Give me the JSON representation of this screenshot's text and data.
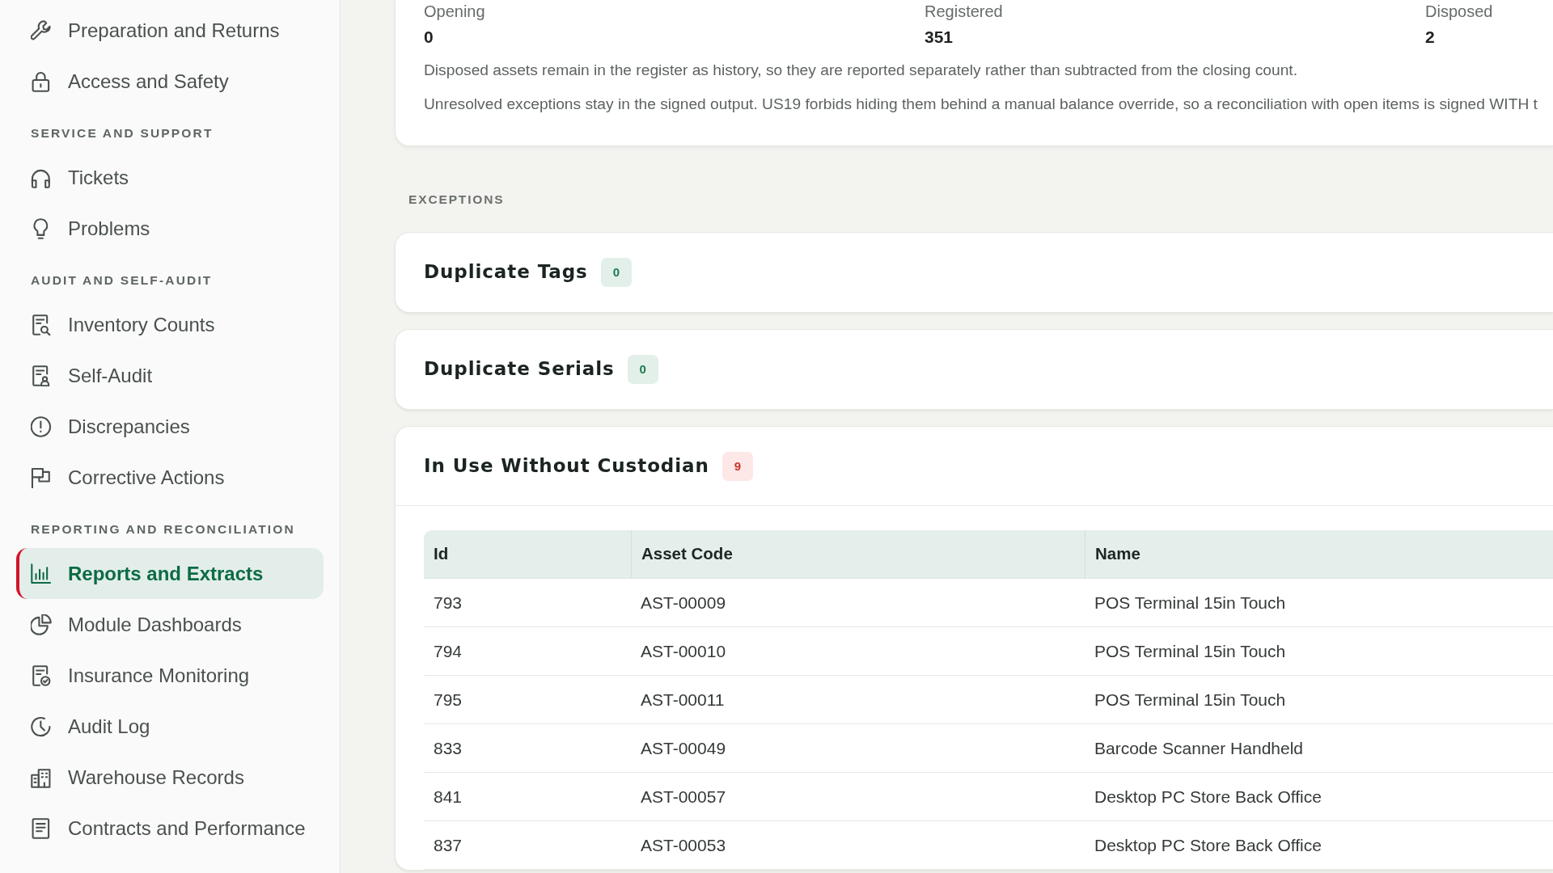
{
  "sidebar": {
    "sections": [
      {
        "items": [
          {
            "label": "Preparation and Returns",
            "selected": false
          },
          {
            "label": "Access and Safety",
            "selected": false
          }
        ]
      },
      {
        "heading": "SERVICE AND SUPPORT",
        "items": [
          {
            "label": "Tickets",
            "selected": false
          },
          {
            "label": "Problems",
            "selected": false
          }
        ]
      },
      {
        "heading": "AUDIT AND SELF-AUDIT",
        "items": [
          {
            "label": "Inventory Counts",
            "selected": false
          },
          {
            "label": "Self-Audit",
            "selected": false
          },
          {
            "label": "Discrepancies",
            "selected": false
          },
          {
            "label": "Corrective Actions",
            "selected": false
          }
        ]
      },
      {
        "heading": "REPORTING AND RECONCILIATION",
        "items": [
          {
            "label": "Reports and Extracts",
            "selected": true
          },
          {
            "label": "Module Dashboards",
            "selected": false
          },
          {
            "label": "Insurance Monitoring",
            "selected": false
          },
          {
            "label": "Audit Log",
            "selected": false
          },
          {
            "label": "Warehouse Records",
            "selected": false
          },
          {
            "label": "Contracts and Performance",
            "selected": false
          }
        ]
      }
    ]
  },
  "summary": {
    "stats": [
      {
        "label": "Opening",
        "value": "0"
      },
      {
        "label": "Registered",
        "value": "351"
      },
      {
        "label": "Disposed",
        "value": "2"
      }
    ],
    "notes": [
      "Disposed assets remain in the register as history, so they are reported separately rather than subtracted from the closing count.",
      "Unresolved exceptions stay in the signed output. US19 forbids hiding them behind a manual balance override, so a reconciliation with open items is signed WITH t"
    ]
  },
  "exceptions": {
    "heading": "EXCEPTIONS",
    "items": [
      {
        "title": "Duplicate Tags",
        "count": "0",
        "flagged": false
      },
      {
        "title": "Duplicate Serials",
        "count": "0",
        "flagged": false
      },
      {
        "title": "In Use Without Custodian",
        "count": "9",
        "flagged": true,
        "table": {
          "columns": [
            "Id",
            "Asset Code",
            "Name"
          ],
          "rows": [
            [
              "793",
              "AST-00009",
              "POS Terminal 15in Touch"
            ],
            [
              "794",
              "AST-00010",
              "POS Terminal 15in Touch"
            ],
            [
              "795",
              "AST-00011",
              "POS Terminal 15in Touch"
            ],
            [
              "833",
              "AST-00049",
              "Barcode Scanner Handheld"
            ],
            [
              "841",
              "AST-00057",
              "Desktop PC Store Back Office"
            ],
            [
              "837",
              "AST-00053",
              "Desktop PC Store Back Office"
            ]
          ]
        }
      }
    ]
  }
}
